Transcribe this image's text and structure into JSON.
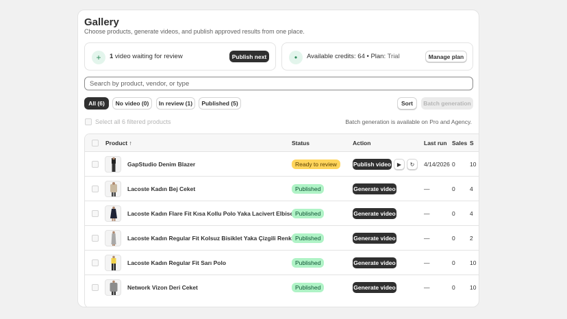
{
  "header": {
    "title": "Gallery",
    "subtitle": "Choose products, generate videos, and publish approved results from one place."
  },
  "review_box": {
    "icon": "plus-icon",
    "count": "1",
    "text": " video waiting for review",
    "button": "Publish next"
  },
  "credits_box": {
    "icon": "dot-icon",
    "credits_text": "Available credits: 64 • Plan: ",
    "plan": "Trial",
    "button": "Manage plan"
  },
  "search": {
    "placeholder": "Search by product, vendor, or type",
    "value": ""
  },
  "filters": [
    {
      "label": "All (6)",
      "active": true
    },
    {
      "label": "No video (0)",
      "active": false
    },
    {
      "label": "In review (1)",
      "active": false
    },
    {
      "label": "Published (5)",
      "active": false
    }
  ],
  "toolbar": {
    "sort": "Sort",
    "batch": "Batch generation"
  },
  "select_all_label": "Select all 6 filtered products",
  "batch_note": "Batch generation is available on Pro and Agency.",
  "table": {
    "columns": {
      "product": "Product",
      "sort_icon": "↑",
      "status": "Status",
      "action": "Action",
      "last_run": "Last run",
      "sales": "Sales",
      "extra": "S"
    },
    "rows": [
      {
        "name": "GapStudio Denim Blazer",
        "status": "Ready to review",
        "status_kind": "ready",
        "action": "Publish video",
        "last_run": "4/14/2026",
        "sales": "0",
        "extra": "10"
      },
      {
        "name": "Lacoste Kadın Bej Ceket",
        "status": "Published",
        "status_kind": "published",
        "action": "Generate video",
        "last_run": "—",
        "sales": "0",
        "extra": "4"
      },
      {
        "name": "Lacoste Kadın Flare Fit Kısa Kollu Polo Yaka Lacivert Elbise",
        "status": "Published",
        "status_kind": "published",
        "action": "Generate video",
        "last_run": "—",
        "sales": "0",
        "extra": "4"
      },
      {
        "name": "Lacoste Kadın Regular Fit Kolsuz Bisiklet Yaka Çizgili Renkli Elbise",
        "status": "Published",
        "status_kind": "published",
        "action": "Generate video",
        "last_run": "—",
        "sales": "0",
        "extra": "2"
      },
      {
        "name": "Lacoste Kadın Regular Fit Sarı Polo",
        "status": "Published",
        "status_kind": "published",
        "action": "Generate video",
        "last_run": "—",
        "sales": "0",
        "extra": "10"
      },
      {
        "name": "Network Vizon Deri Ceket",
        "status": "Published",
        "status_kind": "published",
        "action": "Generate video",
        "last_run": "—",
        "sales": "0",
        "extra": "10"
      }
    ]
  }
}
